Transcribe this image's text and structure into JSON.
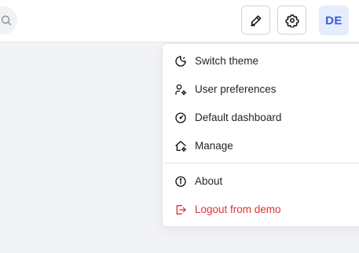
{
  "header": {
    "search_icon": "search-icon",
    "pen_icon": "pen-icon",
    "settings_icon": "gear-icon",
    "avatar_initials": "DE"
  },
  "menu": {
    "items": [
      {
        "label": "Switch theme",
        "icon": "moon-icon"
      },
      {
        "label": "User preferences",
        "icon": "user-settings-icon"
      },
      {
        "label": "Default dashboard",
        "icon": "gauge-icon"
      },
      {
        "label": "Manage",
        "icon": "home-settings-icon"
      },
      {
        "label": "About",
        "icon": "info-icon"
      },
      {
        "label": "Logout from demo",
        "icon": "logout-icon"
      }
    ]
  },
  "colors": {
    "accent": "#3b5bdb",
    "avatar_bg": "#e5ecfb",
    "danger": "#e03131",
    "page_bg": "#f2f3f5"
  }
}
